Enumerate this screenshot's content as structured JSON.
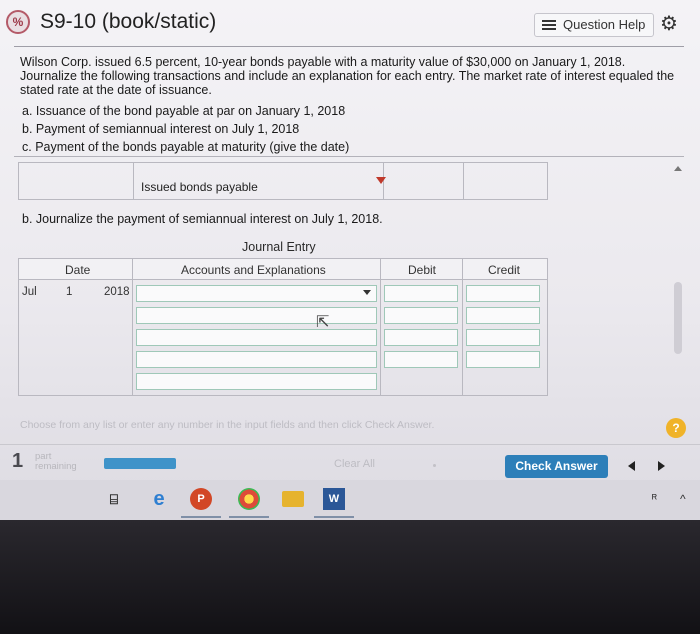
{
  "header": {
    "title": "S9-10 (book/static)",
    "question_help": "Question Help",
    "logo_glyph": "%"
  },
  "problem": {
    "prompt": "Wilson Corp. issued 6.5 percent, 10-year bonds payable with a maturity value of $30,000 on January 1, 2018. Journalize the following transactions and include an explanation for each entry. The market rate of interest equaled the stated rate at the date of issuance.",
    "items": [
      "a. Issuance of the bond payable at par on January 1, 2018",
      "b. Payment of semiannual interest on July 1, 2018",
      "c. Payment of the bonds payable at maturity (give the date)"
    ]
  },
  "previous_entry": {
    "explanation": "Issued bonds payable"
  },
  "part_b": {
    "instruction": "b. Journalize the payment of semiannual interest on July 1, 2018.",
    "journal_title": "Journal Entry",
    "columns": {
      "date": "Date",
      "accounts": "Accounts and Explanations",
      "debit": "Debit",
      "credit": "Credit"
    },
    "date": {
      "month": "Jul",
      "day": "1",
      "year": "2018"
    }
  },
  "footer": {
    "hint": "Choose from any list or enter any number in the input fields and then click Check Answer.",
    "part_number": "1",
    "part_label": "part",
    "remaining_label": "remaining",
    "progress": 1.0,
    "clear_all": "Clear All",
    "check_answer": "Check Answer",
    "help_glyph": "?"
  },
  "taskbar": {
    "icons": [
      "task-view-icon",
      "edge-icon",
      "powerpoint-icon",
      "chrome-icon",
      "file-explorer-icon",
      "word-icon"
    ],
    "glyphs": {
      "word": "W",
      "ppt": "P",
      "tray": "ᴿ"
    }
  },
  "colors": {
    "accent": "#2d7fb9",
    "progress": "#3f93c9",
    "help": "#f0b329",
    "input_border": "#9fc8b8"
  }
}
